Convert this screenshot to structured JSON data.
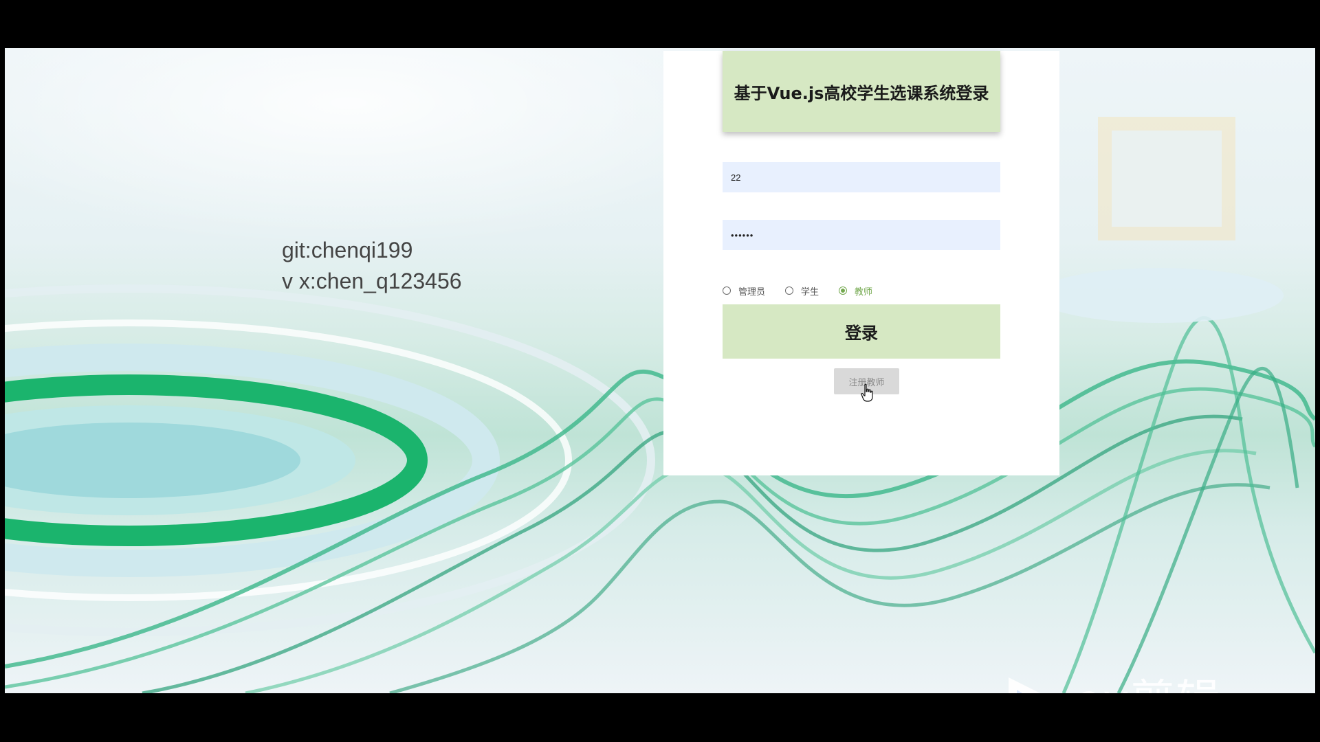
{
  "credit": {
    "line1": "git:chenqi199",
    "line2": "v x:chen_q123456"
  },
  "login": {
    "title": "基于Vue.js高校学生选课系统登录",
    "username_value": "22",
    "password_value": "••••••",
    "roles": [
      {
        "label": "管理员",
        "checked": false
      },
      {
        "label": "学生",
        "checked": false
      },
      {
        "label": "教师",
        "checked": true
      }
    ],
    "login_button": "登录",
    "register_button": "注册教师"
  },
  "watermark": {
    "text": "ev剪辑"
  },
  "colors": {
    "panel_green": "#d6e8c3",
    "input_bg": "#e8f0fe",
    "radio_checked": "#73a84e",
    "register_bg": "#d9d9d9"
  },
  "icons": [
    "hand-cursor-icon",
    "ev-logo-icon"
  ]
}
